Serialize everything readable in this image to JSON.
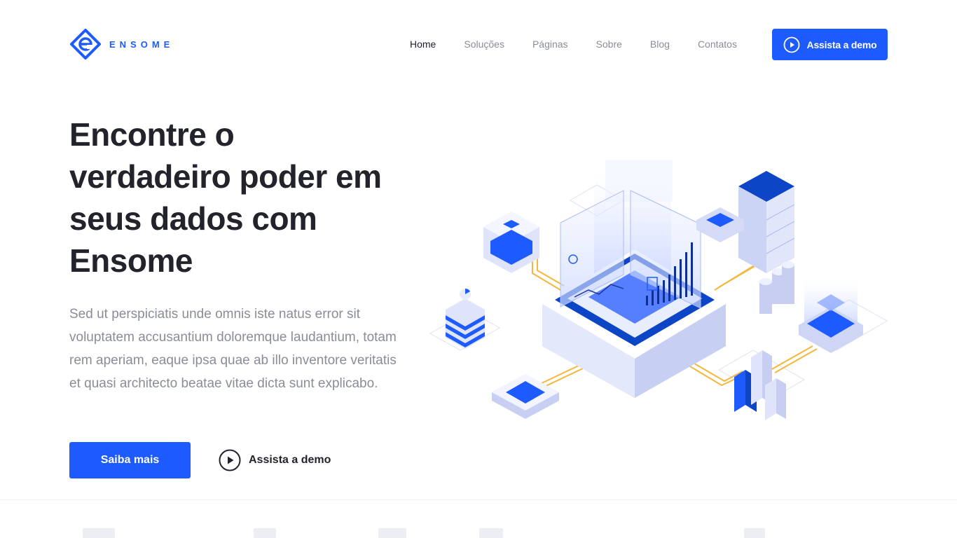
{
  "brand": {
    "name": "ENSOME",
    "color": "#1e5bff"
  },
  "nav": {
    "items": [
      {
        "label": "Home",
        "active": true
      },
      {
        "label": "Soluções",
        "active": false
      },
      {
        "label": "Páginas",
        "active": false
      },
      {
        "label": "Sobre",
        "active": false
      },
      {
        "label": "Blog",
        "active": false
      },
      {
        "label": "Contatos",
        "active": false
      }
    ],
    "cta_label": "Assista a demo",
    "cta_icon": "play-circle-icon"
  },
  "hero": {
    "title_lines": [
      "Encontre o",
      "verdadeiro poder em",
      "seus dados com",
      "Ensome"
    ],
    "description": "Sed ut perspiciatis unde omnis iste natus error sit voluptatem accusantium doloremque laudantium, totam rem aperiam, eaque ipsa quae ab illo inventore veritatis et quasi architecto beatae vitae dicta sunt explicabo.",
    "primary_button": "Saiba mais",
    "demo_button": "Assista a demo",
    "demo_icon": "play-circle-icon"
  },
  "colors": {
    "accent": "#1e5bff",
    "text_dark": "#22232b",
    "text_muted": "#8a8c97"
  }
}
